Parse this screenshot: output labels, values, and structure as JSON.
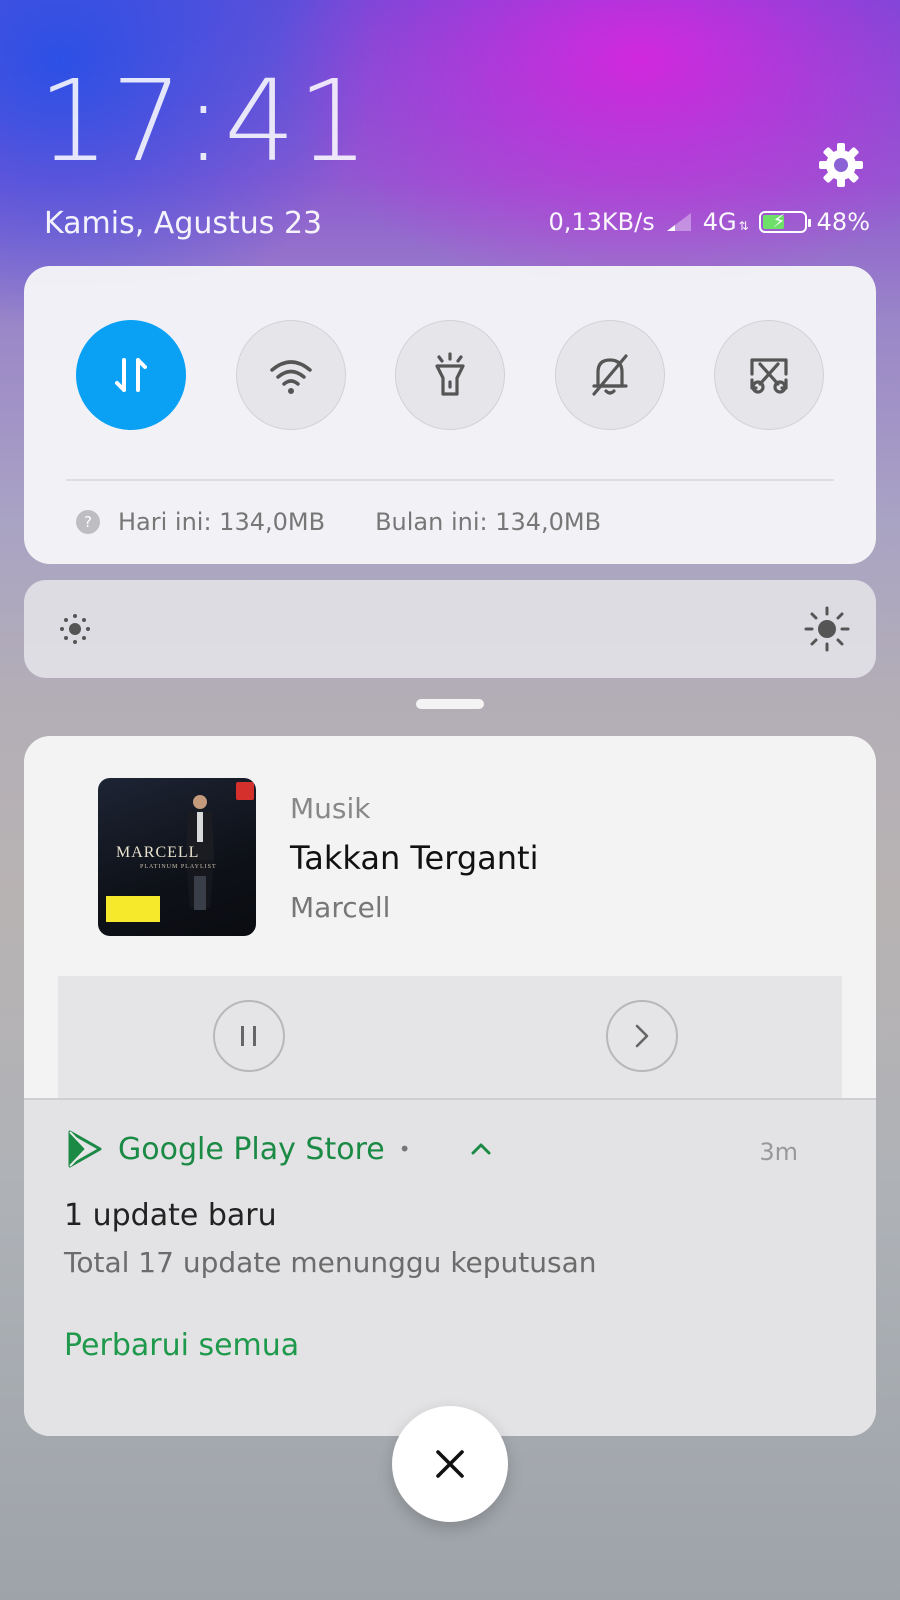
{
  "lockscreen": {
    "time": "17:41",
    "date": "Kamis, Agustus 23"
  },
  "status_bar": {
    "speed": "0,13KB/s",
    "network": "4G",
    "battery": "48%",
    "battery_level": 0.48,
    "icons": [
      "signal-icon",
      "battery-charging-icon",
      "settings-gear-icon"
    ]
  },
  "quick_settings": {
    "toggles": [
      {
        "name": "mobile-data",
        "icon": "data-transfer-icon",
        "active": true
      },
      {
        "name": "wifi",
        "icon": "wifi-icon",
        "active": false
      },
      {
        "name": "flashlight",
        "icon": "flashlight-icon",
        "active": false
      },
      {
        "name": "silent",
        "icon": "bell-off-icon",
        "active": false
      },
      {
        "name": "screenshot",
        "icon": "screenshot-icon",
        "active": false
      }
    ],
    "usage_today": "Hari ini: 134,0MB",
    "usage_month": "Bulan ini: 134,0MB"
  },
  "music": {
    "app": "Musik",
    "song": "Takkan Terganti",
    "artist": "Marcell",
    "album_art": {
      "title": "MARCELL",
      "subtitle": "PLATINUM PLAYLIST"
    }
  },
  "play_notification": {
    "app": "Google Play Store",
    "dot": "•",
    "time": "3m",
    "title": "1 update baru",
    "text": "Total 17 update menunggu keputusan",
    "action": "Perbarui semua"
  },
  "colors": {
    "accent_blue": "#0aa1f5",
    "play_green": "#1b8a45"
  }
}
